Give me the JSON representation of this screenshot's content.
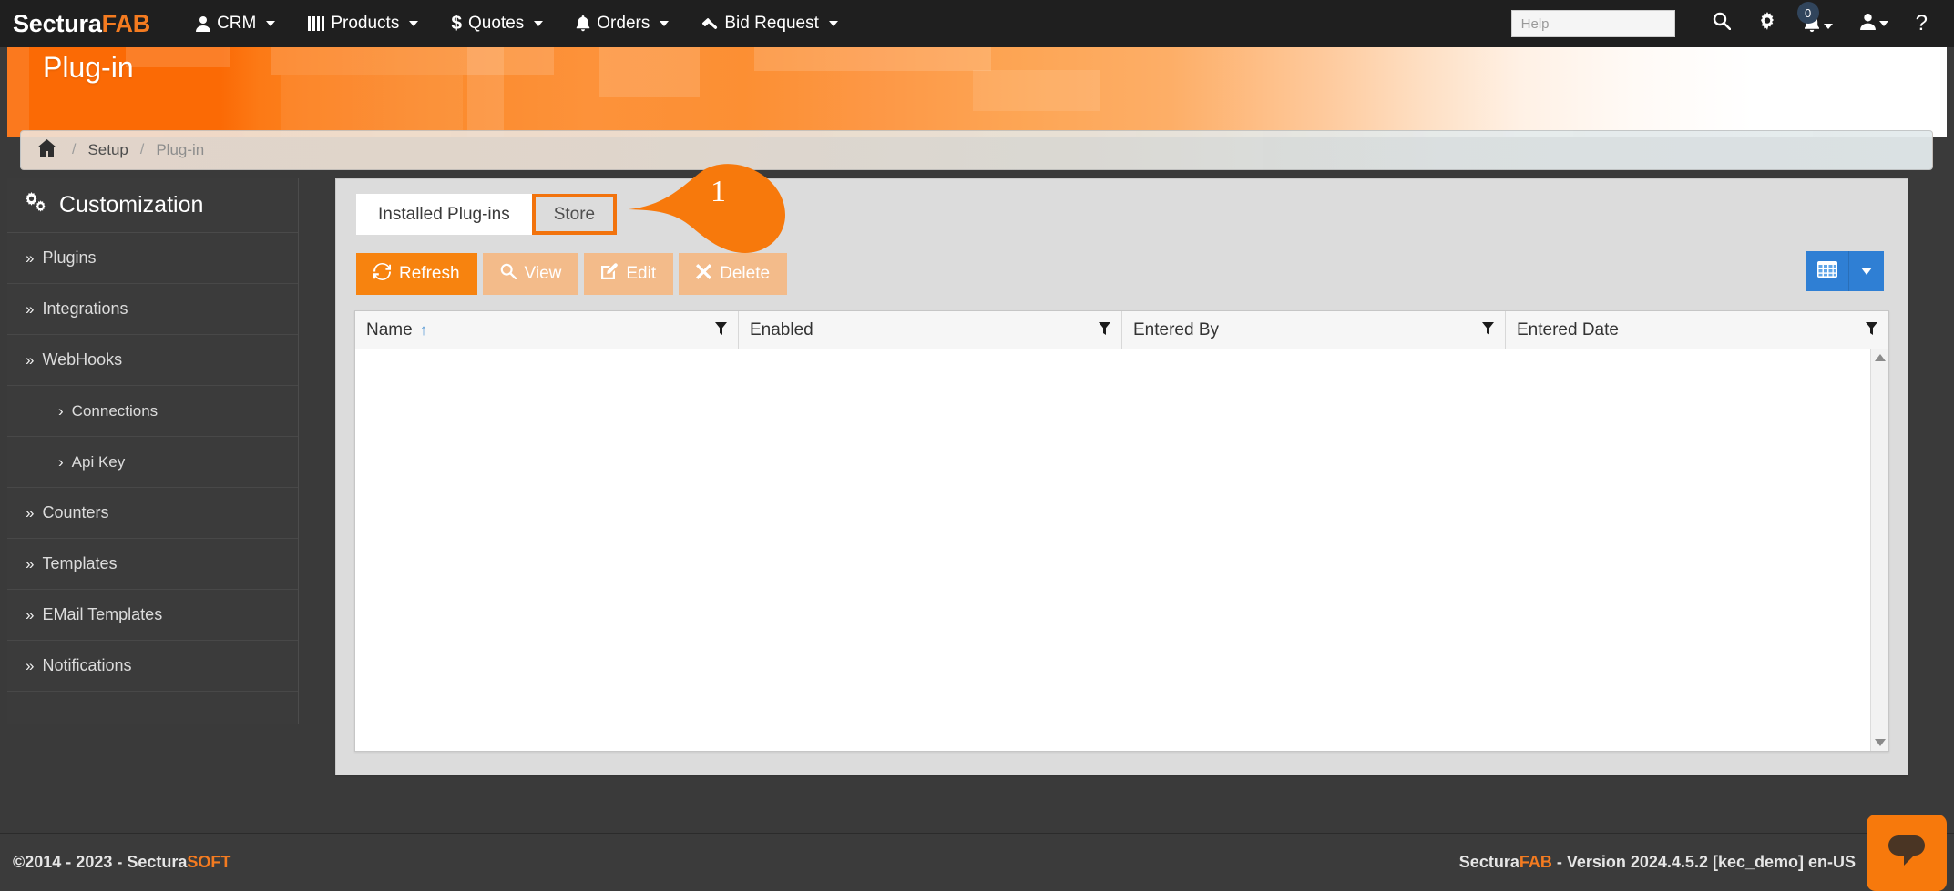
{
  "navbar": {
    "brand_main": "Sectura",
    "brand_accent": "FAB",
    "items": [
      {
        "label": "CRM",
        "icon": "user-icon"
      },
      {
        "label": "Products",
        "icon": "bars-icon"
      },
      {
        "label": "Quotes",
        "icon": "dollar-icon"
      },
      {
        "label": "Orders",
        "icon": "bell-icon"
      },
      {
        "label": "Bid Request",
        "icon": "gavel-icon"
      }
    ],
    "help_placeholder": "Help",
    "help_value": "",
    "search_icon": "search-icon",
    "settings_icon": "gear-icon",
    "notification_icon": "bell-icon",
    "notification_count": "0",
    "user_icon": "user-icon",
    "help_icon": "question-mark-icon"
  },
  "banner": {
    "title": "Plug-in"
  },
  "breadcrumb": {
    "home_icon": "home-icon",
    "separator": "/",
    "items": [
      {
        "label": "Setup",
        "current": false
      },
      {
        "label": "Plug-in",
        "current": true
      }
    ]
  },
  "sidebar": {
    "heading": "Customization",
    "heading_icon": "gears-icon",
    "items": [
      {
        "label": "Plugins",
        "marker": "»",
        "sub": false
      },
      {
        "label": "Integrations",
        "marker": "»",
        "sub": false
      },
      {
        "label": "WebHooks",
        "marker": "»",
        "sub": false
      },
      {
        "label": "Connections",
        "marker": "›",
        "sub": true
      },
      {
        "label": "Api Key",
        "marker": "›",
        "sub": true
      },
      {
        "label": "Counters",
        "marker": "»",
        "sub": false
      },
      {
        "label": "Templates",
        "marker": "»",
        "sub": false
      },
      {
        "label": "EMail Templates",
        "marker": "»",
        "sub": false
      },
      {
        "label": "Notifications",
        "marker": "»",
        "sub": false
      }
    ]
  },
  "main": {
    "tabs": [
      {
        "label": "Installed Plug-ins",
        "state": "active"
      },
      {
        "label": "Store",
        "state": "highlighted"
      }
    ],
    "toolbar": [
      {
        "label": "Refresh",
        "icon": "refresh-icon",
        "style": "primary"
      },
      {
        "label": "View",
        "icon": "magnifier-icon",
        "style": "muted"
      },
      {
        "label": "Edit",
        "icon": "pencil-square-icon",
        "style": "muted"
      },
      {
        "label": "Delete",
        "icon": "x-icon",
        "style": "muted"
      }
    ],
    "grid_button_icon": "table-grid-icon",
    "grid_caret_icon": "chevron-down-icon",
    "grid": {
      "columns": [
        {
          "label": "Name",
          "sort": "asc",
          "filter_icon": "funnel-icon"
        },
        {
          "label": "Enabled",
          "sort": "",
          "filter_icon": "funnel-icon"
        },
        {
          "label": "Entered By",
          "sort": "",
          "filter_icon": "funnel-icon"
        },
        {
          "label": "Entered Date",
          "sort": "",
          "filter_icon": "funnel-icon"
        }
      ],
      "rows": [],
      "sort_indicator": "↑"
    }
  },
  "callout": {
    "number": "1"
  },
  "footer": {
    "left_prefix": "©2014 - 2023 - Sectura",
    "left_accent": "SOFT",
    "right_brand_main": "Sectura",
    "right_brand_accent": "FAB",
    "right_rest": " - Version 2024.4.5.2 [kec_demo] en-US",
    "chat_icon": "chat-bubble-icon"
  },
  "colors": {
    "brand_orange": "#f47b20",
    "navbar_bg": "#1f1f1f",
    "sidebar_bg": "#3b3b3b",
    "grid_button_blue": "#2f7fd4",
    "highlight_orange": "#f2730d"
  }
}
